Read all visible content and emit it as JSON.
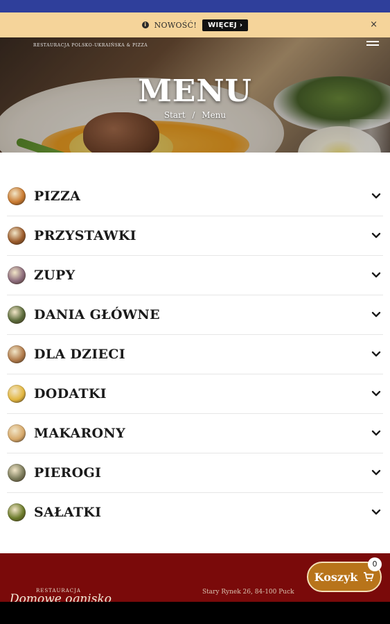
{
  "notice": {
    "text": "NOWOŚĆ!",
    "button": "WIĘCEJ ›",
    "close": "×"
  },
  "hero": {
    "tagline": "RESTAURACJA POLSKO-UKRAIŃSKA & PIZZA",
    "title": "MENU",
    "breadcrumb": {
      "home": "Start",
      "separator": "/",
      "current": "Menu"
    }
  },
  "categories": [
    {
      "label": "PIZZA",
      "icon": "pizza-thumb",
      "color": "#c8792f"
    },
    {
      "label": "PRZYSTAWKI",
      "icon": "starters-thumb",
      "color": "#9a5a2a"
    },
    {
      "label": "ZUPY",
      "icon": "soup-thumb",
      "color": "#8a6a7a"
    },
    {
      "label": "DANIA GŁÓWNE",
      "icon": "main-dish-thumb",
      "color": "#5a6a3a"
    },
    {
      "label": "DLA DZIECI",
      "icon": "kids-thumb",
      "color": "#b07a4a"
    },
    {
      "label": "DODATKI",
      "icon": "sides-thumb",
      "color": "#e2b640"
    },
    {
      "label": "MAKARONY",
      "icon": "pasta-thumb",
      "color": "#d6a86a"
    },
    {
      "label": "PIEROGI",
      "icon": "dumplings-thumb",
      "color": "#7a7a5a"
    },
    {
      "label": "SAŁATKI",
      "icon": "salad-thumb",
      "color": "#6a7a2a"
    }
  ],
  "footer": {
    "logo_small": "RESTAURACJA",
    "logo": "Domowe ognisko",
    "address": "Stary Rynek 26, 84-100 Puck",
    "cart_label": "Koszyk",
    "cart_count": "0"
  },
  "colors": {
    "accent": "#2f3f9b",
    "notice_bg": "#f5d49a",
    "footer_bg": "#7a0a0a",
    "cart_bg": "#b8741a"
  }
}
